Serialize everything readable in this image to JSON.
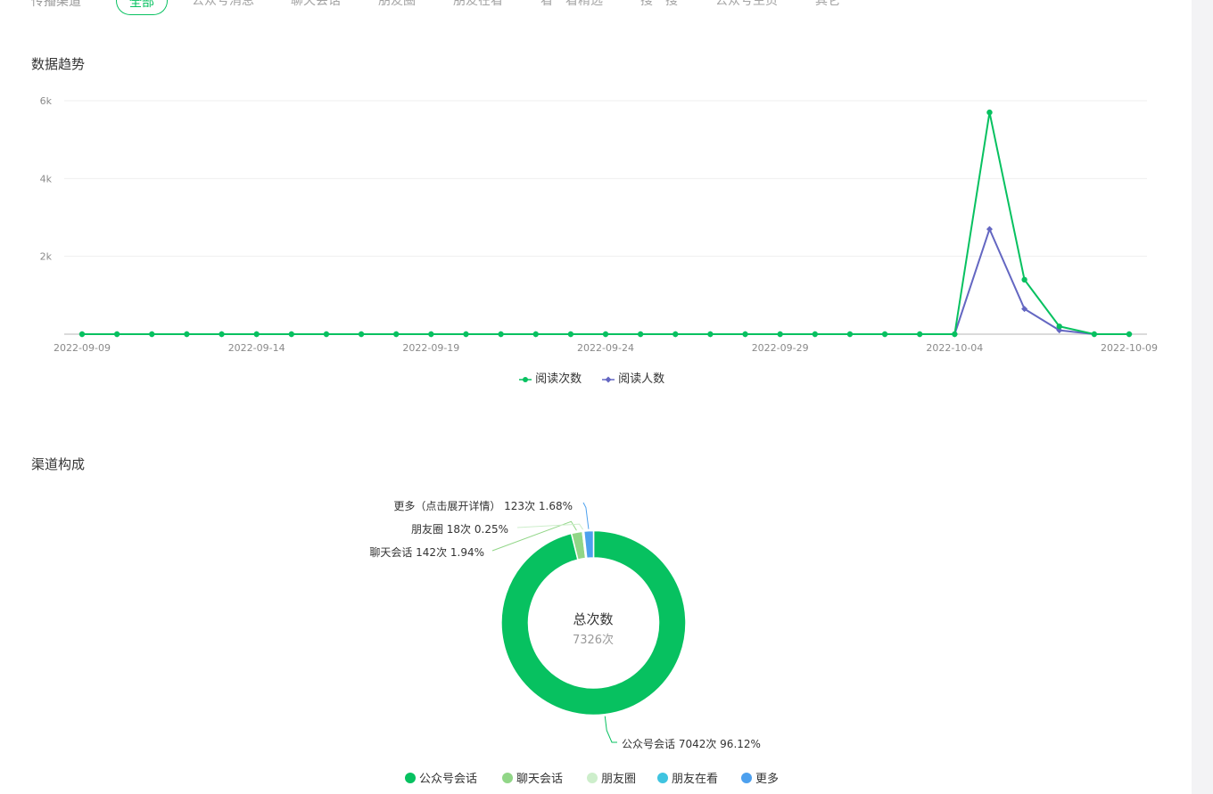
{
  "filter": {
    "label": "传播渠道",
    "tabs": [
      "全部",
      "公众号消息",
      "聊天会话",
      "朋友圈",
      "朋友在看",
      "看一看精选",
      "搜一搜",
      "公众号主页",
      "其它"
    ],
    "active_index": 0
  },
  "trend": {
    "title": "数据趋势",
    "legend": [
      "阅读次数",
      "阅读人数"
    ]
  },
  "composition": {
    "title": "渠道构成",
    "center_title": "总次数",
    "center_value": "7326次",
    "legend": [
      "公众号会话",
      "聊天会话",
      "朋友圈",
      "朋友在看",
      "更多"
    ],
    "labels": {
      "more": "更多（点击展开详情） 123次 1.68%",
      "moments": "朋友圈 18次 0.25%",
      "chat": "聊天会话 142次 1.94%",
      "official": "公众号会话 7042次 96.12%"
    }
  },
  "chart_data": [
    {
      "type": "line",
      "title": "数据趋势",
      "x": [
        "2022-09-09",
        "2022-09-10",
        "2022-09-11",
        "2022-09-12",
        "2022-09-13",
        "2022-09-14",
        "2022-09-15",
        "2022-09-16",
        "2022-09-17",
        "2022-09-18",
        "2022-09-19",
        "2022-09-20",
        "2022-09-21",
        "2022-09-22",
        "2022-09-23",
        "2022-09-24",
        "2022-09-25",
        "2022-09-26",
        "2022-09-27",
        "2022-09-28",
        "2022-09-29",
        "2022-09-30",
        "2022-10-01",
        "2022-10-02",
        "2022-10-03",
        "2022-10-04",
        "2022-10-05",
        "2022-10-06",
        "2022-10-07",
        "2022-10-08",
        "2022-10-09"
      ],
      "x_tick_labels": [
        "2022-09-09",
        "2022-09-14",
        "2022-09-19",
        "2022-09-24",
        "2022-09-29",
        "2022-10-04",
        "2022-10-09"
      ],
      "y_tick_labels": [
        "2k",
        "4k",
        "6k"
      ],
      "ylim": [
        0,
        6000
      ],
      "grid": true,
      "legend_position": "bottom-center",
      "series": [
        {
          "name": "阅读次数",
          "color": "#07c160",
          "values": [
            0,
            0,
            0,
            0,
            0,
            0,
            0,
            0,
            0,
            0,
            0,
            0,
            0,
            0,
            0,
            0,
            0,
            0,
            0,
            0,
            0,
            0,
            0,
            0,
            0,
            0,
            5700,
            1400,
            200,
            0,
            0
          ]
        },
        {
          "name": "阅读人数",
          "color": "#6467c2",
          "values": [
            0,
            0,
            0,
            0,
            0,
            0,
            0,
            0,
            0,
            0,
            0,
            0,
            0,
            0,
            0,
            0,
            0,
            0,
            0,
            0,
            0,
            0,
            0,
            0,
            0,
            0,
            2700,
            650,
            100,
            0,
            0
          ]
        }
      ]
    },
    {
      "type": "pie",
      "title": "渠道构成",
      "slices": [
        {
          "label": "公众号会话",
          "value": 7042,
          "percent": 96.12,
          "color": "#07c160"
        },
        {
          "label": "聊天会话",
          "value": 142,
          "percent": 1.94,
          "color": "#91d687"
        },
        {
          "label": "朋友圈",
          "value": 18,
          "percent": 0.25,
          "color": "#cdeecb"
        },
        {
          "label": "朋友在看",
          "value": 0,
          "percent": 0,
          "color": "#3fc4e0"
        },
        {
          "label": "更多（点击展开详情）",
          "value": 123,
          "percent": 1.68,
          "color": "#4da0ee"
        }
      ]
    }
  ]
}
